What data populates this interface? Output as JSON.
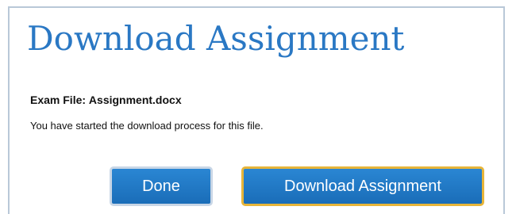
{
  "dialog": {
    "title": "Download Assignment",
    "file_label": "Exam File:",
    "file_name": "Assignment.docx",
    "message": "You have started the download process for this file."
  },
  "buttons": {
    "done_label": "Done",
    "download_label": "Download Assignment"
  },
  "colors": {
    "title": "#2a78c4",
    "button_fill": "#1a6db8",
    "primary_button_border": "#e7b53a",
    "secondary_button_border": "#c8d6e6"
  }
}
